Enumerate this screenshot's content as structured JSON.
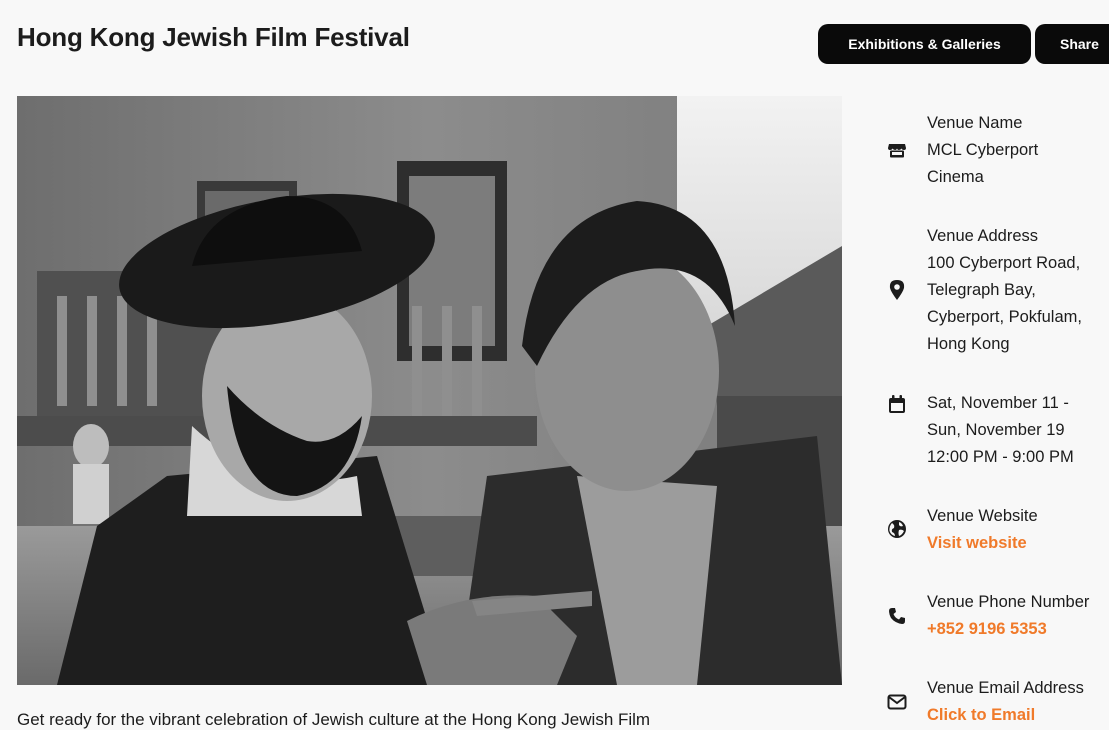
{
  "page": {
    "title": "Hong Kong Jewish Film Festival"
  },
  "header_actions": {
    "galleries_label": "Exhibitions & Galleries",
    "share_label": "Share"
  },
  "intro_text": "Get ready for the vibrant celebration of Jewish culture at the Hong Kong Jewish Film",
  "venue": {
    "name_label": "Venue Name",
    "name_line1": "MCL Cyberport",
    "name_line2": "Cinema",
    "address_label": "Venue Address",
    "address_line1": "100 Cyberport Road,",
    "address_line2": "Telegraph Bay,",
    "address_line3": "Cyberport, Pokfulam,",
    "address_line4": "Hong Kong",
    "date_line1": "Sat, November 11 -",
    "date_line2": "Sun, November 19",
    "time_line": "12:00 PM - 9:00 PM",
    "website_label": "Venue Website",
    "website_link": "Visit website",
    "phone_label": "Venue Phone Number",
    "phone_value": "+852 9196 5353",
    "email_label": "Venue Email Address",
    "email_link": "Click to Email"
  },
  "colors": {
    "accent": "#f07a2a",
    "button_bg": "#0a0a0a",
    "page_bg": "#f8f8f8"
  },
  "icons": [
    "store-icon",
    "map-pin-icon",
    "calendar-icon",
    "globe-icon",
    "phone-icon",
    "envelope-icon"
  ]
}
